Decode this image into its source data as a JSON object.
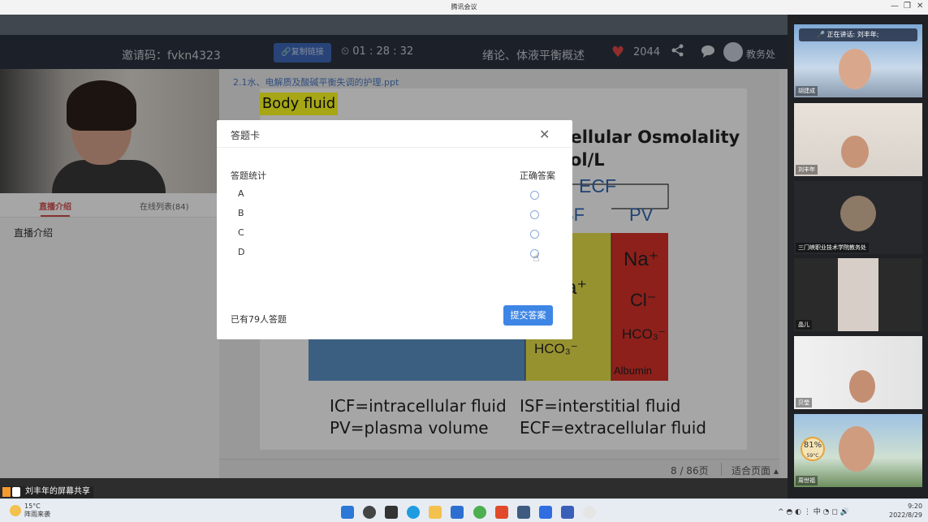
{
  "window": {
    "title": "腾讯会议",
    "minimize": "—",
    "restore": "❐",
    "close": "✕"
  },
  "header": {
    "invite": "邀请码：fvkn4323",
    "copy_label": "复制链接",
    "timer": "01 : 28 : 32",
    "course": "绪论、体液平衡概述",
    "likes": "2044",
    "user": "教务处"
  },
  "left": {
    "tabs": [
      "直播介绍",
      "在线列表(84)"
    ],
    "intro": "直播介绍"
  },
  "slide": {
    "file": "2.1水、电解质及酸碱平衡失调的护理.ppt",
    "title": "Body fluid",
    "osmolality": "cellular Osmolality",
    "unit": "ol/L",
    "labels": {
      "ecf": "ECF",
      "isf": "SF",
      "pv": "PV",
      "na1": "a⁺",
      "na2": "Na⁺",
      "cl": "Cl⁻",
      "hco1": "HCO₃⁻",
      "hco2": "HCO₃⁻",
      "albumin": "Albumin"
    },
    "legend": [
      "ICF=intracellular fluid",
      "ISF=interstitial fluid",
      "PV=plasma volume",
      "ECF=extracellular fluid"
    ],
    "page": "8 / 86页",
    "fit": "适合页面 ▴"
  },
  "dialog": {
    "title": "答题卡",
    "close": "✕",
    "stats": "答题统计",
    "correct": "正确答案",
    "options": [
      "A",
      "B",
      "C",
      "D"
    ],
    "answered": "已有79人答题",
    "submit": "提交答案"
  },
  "share": {
    "label": "刘丰年的屏幕共享"
  },
  "participants": [
    {
      "name": "胡建成",
      "speaking": "正在讲话: 刘丰年;"
    },
    {
      "name": "刘丰年"
    },
    {
      "name": "三门峡职业技术学院教务处"
    },
    {
      "name": "晶儿"
    },
    {
      "name": "贝瑩"
    },
    {
      "name": "周世福",
      "badge": "81%",
      "badge_sub": "59°C"
    }
  ],
  "taskbar": {
    "temp": "15°C",
    "weather": "阵雨来袭",
    "tray": "^ ◓ ◐ ⋮ 中 ◔ ◻ 🔊",
    "time": "9:20",
    "date": "2022/8/29"
  },
  "colors": {
    "header_bg": "#2b3340",
    "accent_blue": "#3e86e5",
    "red": "#d24c4c"
  }
}
